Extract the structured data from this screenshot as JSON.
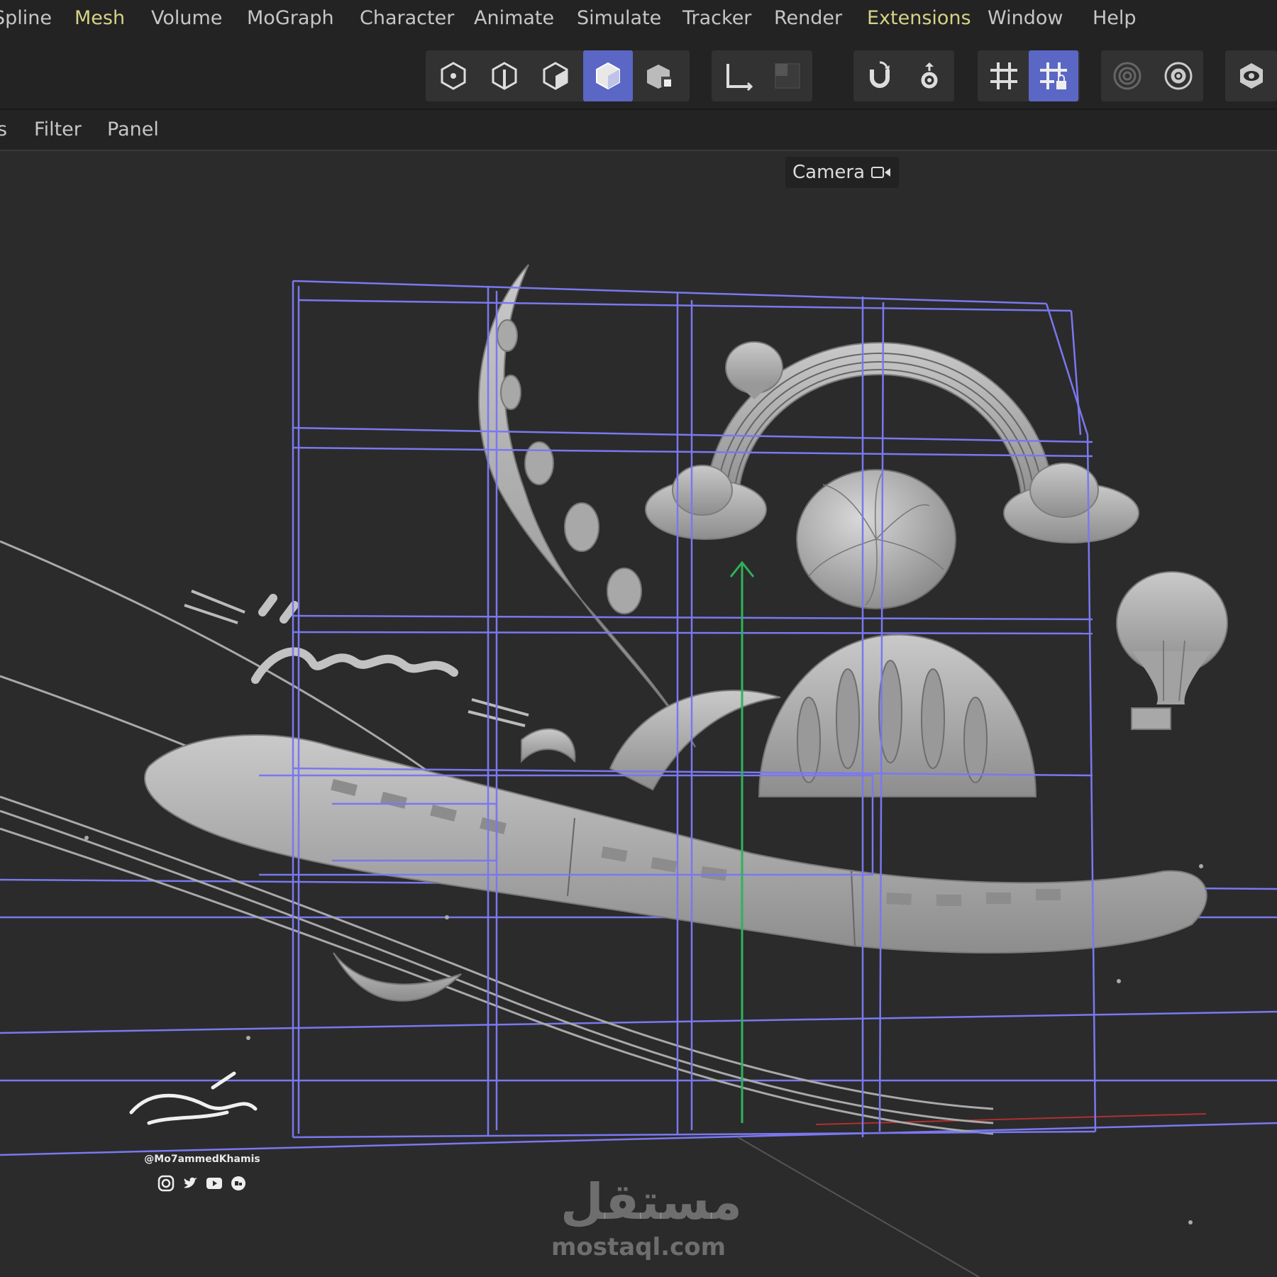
{
  "menubar": {
    "items": [
      "Spline",
      "Mesh",
      "Volume",
      "MoGraph",
      "Character",
      "Animate",
      "Simulate",
      "Tracker",
      "Render",
      "Extensions",
      "Window",
      "Help"
    ]
  },
  "toolbar": {
    "groups": [
      {
        "name": "mode-group",
        "buttons": [
          {
            "icon": "points-mode-icon",
            "active": false
          },
          {
            "icon": "edges-mode-icon",
            "active": false
          },
          {
            "icon": "polygons-mode-icon",
            "active": false
          },
          {
            "icon": "model-mode-icon",
            "active": true
          },
          {
            "icon": "texture-mode-icon",
            "active": false
          }
        ]
      },
      {
        "name": "axis-group",
        "buttons": [
          {
            "icon": "axis-mode-icon",
            "active": false
          },
          {
            "icon": "workplane-icon",
            "active": false
          }
        ]
      },
      {
        "name": "snap-group",
        "buttons": [
          {
            "icon": "magnet-snap-icon",
            "active": false
          },
          {
            "icon": "snap-settings-icon",
            "active": false
          }
        ]
      },
      {
        "name": "grid-group",
        "buttons": [
          {
            "icon": "grid-icon",
            "active": false
          },
          {
            "icon": "grid-lock-icon",
            "active": true
          }
        ]
      },
      {
        "name": "render-group",
        "buttons": [
          {
            "icon": "render-view-icon",
            "active": false
          },
          {
            "icon": "render-settings-icon",
            "active": false
          }
        ]
      },
      {
        "name": "view-group",
        "buttons": [
          {
            "icon": "viewport-eye-icon",
            "active": false
          }
        ]
      }
    ]
  },
  "subbar": {
    "items": [
      "s",
      "Filter",
      "Panel"
    ]
  },
  "viewport": {
    "camera_label": "Camera",
    "accent_color": "#7a78f0"
  },
  "artist": {
    "handle": "@Mo7ammedKhamis",
    "socials": [
      "instagram-icon",
      "twitter-icon",
      "youtube-icon",
      "behance-icon"
    ]
  },
  "watermark": {
    "arabic": "مستقل",
    "latin": "mostaql.com"
  }
}
